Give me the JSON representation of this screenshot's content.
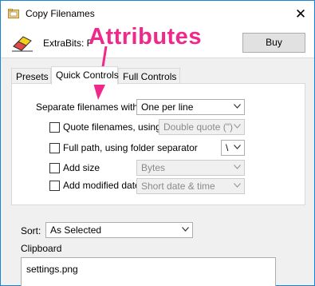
{
  "window": {
    "title": "Copy Filenames",
    "close_glyph": "✕"
  },
  "header": {
    "product_text": "ExtraBits: Fr",
    "buy_label": "Buy"
  },
  "annotation": {
    "text": "Attributes",
    "color": "#f0288b"
  },
  "tabs": [
    {
      "label": "Presets",
      "active": false
    },
    {
      "label": "Quick Controls",
      "active": true
    },
    {
      "label": "Full Controls",
      "active": false
    }
  ],
  "quick_controls": {
    "separate_label": "Separate filenames with:",
    "separate_value": "One per line",
    "options": [
      {
        "label": "Quote filenames, using:",
        "checked": false,
        "value": "Double quote (\")",
        "enabled": false
      },
      {
        "label": "Full path, using folder separator",
        "checked": false,
        "value": "\\",
        "enabled": true
      },
      {
        "label": "Add size",
        "checked": false,
        "value": "Bytes",
        "enabled": false
      },
      {
        "label": "Add modified date",
        "checked": false,
        "value": "Short date & time",
        "enabled": false
      }
    ]
  },
  "sort": {
    "label": "Sort:",
    "value": "As Selected"
  },
  "clipboard": {
    "label": "Clipboard",
    "content": "settings.png"
  },
  "colors": {
    "accent_border": "#1883d7",
    "annotation": "#f0288b"
  }
}
